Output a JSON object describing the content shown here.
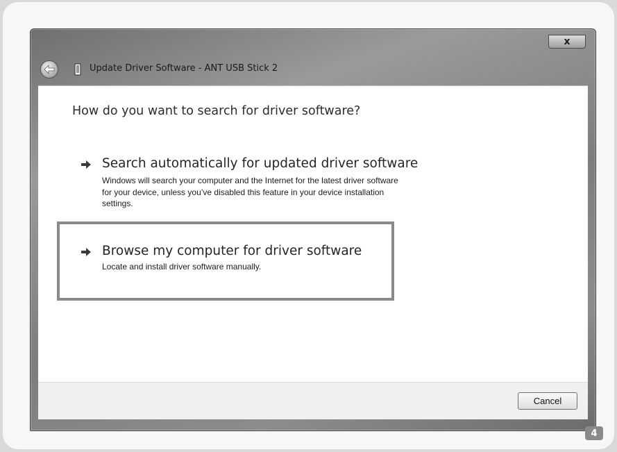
{
  "window": {
    "title": "Update Driver Software - ANT USB Stick 2",
    "close_label": "x"
  },
  "content": {
    "heading": "How do you want to search for driver software?",
    "options": [
      {
        "title": "Search automatically for updated driver software",
        "description_lines": [
          "Windows will search your computer and the Internet for the latest driver software",
          "for your device, unless you’ve disabled this feature in your device installation",
          "settings."
        ]
      },
      {
        "title": "Browse my computer for driver software",
        "description_lines": [
          "Locate and install driver software manually."
        ]
      }
    ]
  },
  "footer": {
    "cancel_label": "Cancel"
  },
  "page_badge": "4",
  "icons": {
    "back": "back-arrow-icon",
    "device": "usb-device-icon",
    "option": "arrow-right-icon"
  }
}
